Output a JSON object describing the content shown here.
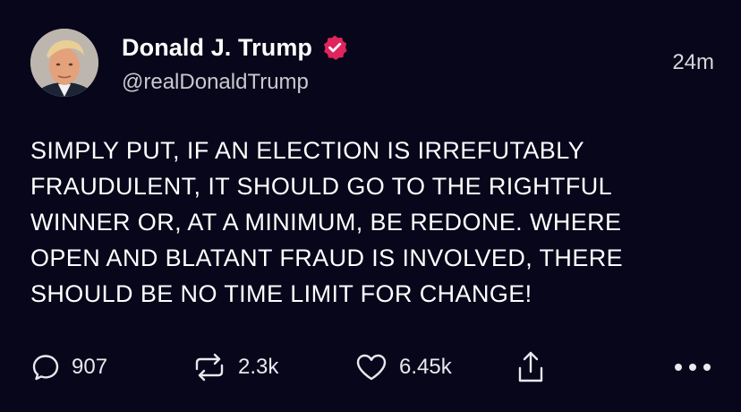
{
  "post": {
    "author": {
      "display_name": "Donald J. Trump",
      "handle": "@realDonaldTrump",
      "verified_icon": "verified-badge-icon",
      "verified_color": "#e0245e"
    },
    "timestamp": "24m",
    "text": "SIMPLY PUT, IF AN ELECTION IS IRREFUTABLY\nFRAUDULENT, IT SHOULD GO TO THE RIGHTFUL\nWINNER OR, AT A MINIMUM, BE REDONE. WHERE\nOPEN AND BLATANT FRAUD IS INVOLVED, THERE\nSHOULD BE NO TIME LIMIT FOR CHANGE!",
    "actions": {
      "replies": "907",
      "reposts": "2.3k",
      "likes": "6.45k",
      "reply_icon": "speech-bubble-icon",
      "repost_icon": "repost-arrows-icon",
      "like_icon": "heart-icon",
      "share_icon": "share-icon",
      "more_icon": "more-dots-icon"
    }
  },
  "colors": {
    "background": "#07061a",
    "text": "#ffffff",
    "secondary_text": "#c9c9cf"
  }
}
